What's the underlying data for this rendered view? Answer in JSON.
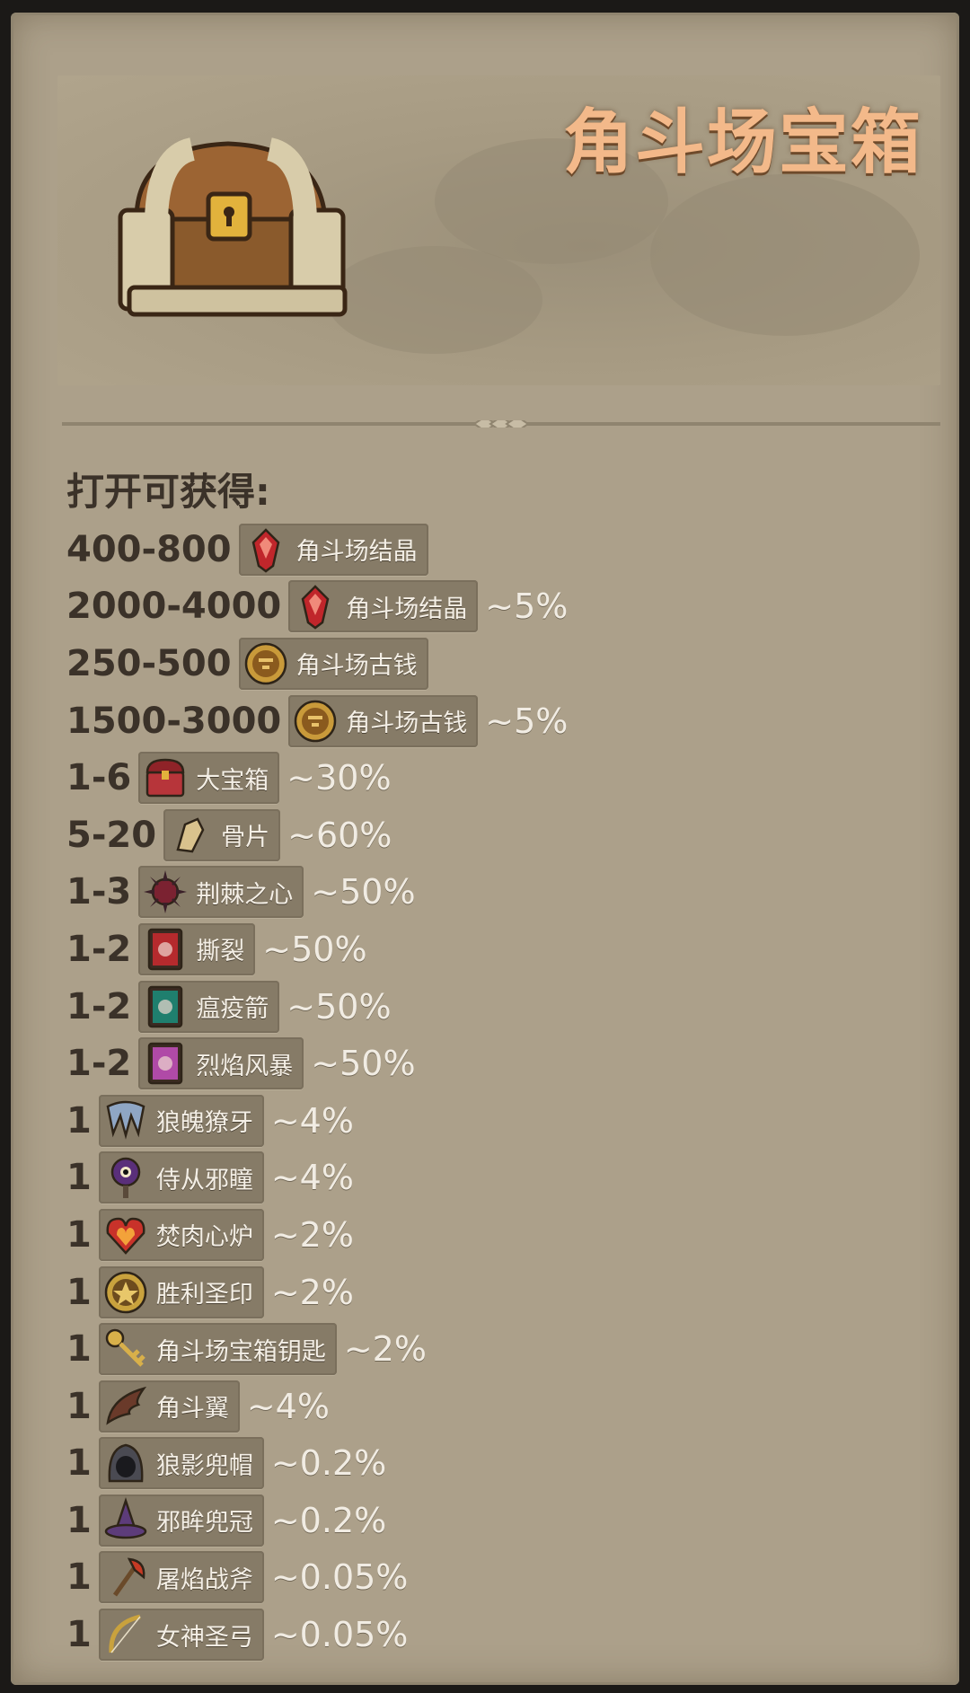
{
  "header": {
    "title": "角斗场宝箱",
    "chest_icon": "treasure-chest-icon"
  },
  "section": {
    "subtitle": "打开可获得:"
  },
  "rewards": [
    {
      "qty": "400-800",
      "name": "角斗场结晶",
      "chance": "",
      "icon": "crystal",
      "color": "#c0262b"
    },
    {
      "qty": "2000-4000",
      "name": "角斗场结晶",
      "chance": "~5%",
      "icon": "crystal",
      "color": "#c0262b"
    },
    {
      "qty": "250-500",
      "name": "角斗场古钱",
      "chance": "",
      "icon": "coin",
      "color": "#c99a3a"
    },
    {
      "qty": "1500-3000",
      "name": "角斗场古钱",
      "chance": "~5%",
      "icon": "coin",
      "color": "#c99a3a"
    },
    {
      "qty": "1-6",
      "name": "大宝箱",
      "chance": "~30%",
      "icon": "chest",
      "color": "#b7353a"
    },
    {
      "qty": "5-20",
      "name": "骨片",
      "chance": "~60%",
      "icon": "bone",
      "color": "#d9c28d"
    },
    {
      "qty": "1-3",
      "name": "荆棘之心",
      "chance": "~50%",
      "icon": "thorn",
      "color": "#7b2231"
    },
    {
      "qty": "1-2",
      "name": "撕裂",
      "chance": "~50%",
      "icon": "card",
      "color": "#b52a2d"
    },
    {
      "qty": "1-2",
      "name": "瘟疫箭",
      "chance": "~50%",
      "icon": "card",
      "color": "#1f7f6e"
    },
    {
      "qty": "1-2",
      "name": "烈焰风暴",
      "chance": "~50%",
      "icon": "card",
      "color": "#b04aa7"
    },
    {
      "qty": "1",
      "name": "狼魄獠牙",
      "chance": "~4%",
      "icon": "fang",
      "color": "#8fa6c4"
    },
    {
      "qty": "1",
      "name": "侍从邪瞳",
      "chance": "~4%",
      "icon": "eye",
      "color": "#5a2f7a"
    },
    {
      "qty": "1",
      "name": "焚肉心炉",
      "chance": "~2%",
      "icon": "heart",
      "color": "#c8322a"
    },
    {
      "qty": "1",
      "name": "胜利圣印",
      "chance": "~2%",
      "icon": "seal",
      "color": "#c9a23d"
    },
    {
      "qty": "1",
      "name": "角斗场宝箱钥匙",
      "chance": "~2%",
      "icon": "key",
      "color": "#d8b04a"
    },
    {
      "qty": "1",
      "name": "角斗翼",
      "chance": "~4%",
      "icon": "wing",
      "color": "#6a3a2a"
    },
    {
      "qty": "1",
      "name": "狼影兜帽",
      "chance": "~0.2%",
      "icon": "hood",
      "color": "#4a4a52"
    },
    {
      "qty": "1",
      "name": "邪眸兜冠",
      "chance": "~0.2%",
      "icon": "hat",
      "color": "#5d3c7a"
    },
    {
      "qty": "1",
      "name": "屠焰战斧",
      "chance": "~0.05%",
      "icon": "axe",
      "color": "#3b3b40"
    },
    {
      "qty": "1",
      "name": "女神圣弓",
      "chance": "~0.05%",
      "icon": "bow",
      "color": "#c9a23d"
    }
  ]
}
